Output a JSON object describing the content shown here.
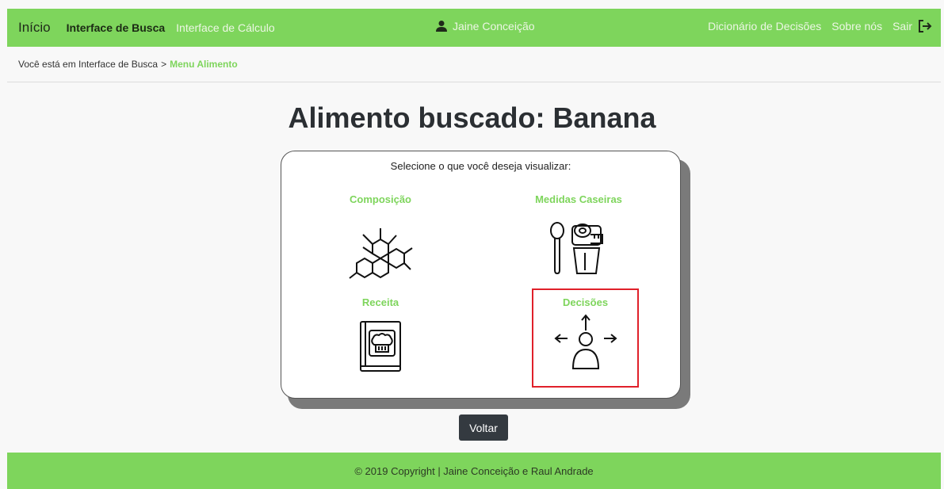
{
  "navbar": {
    "brand": "Início",
    "active_item": "Interface de Busca",
    "items": [
      "Interface de Cálculo"
    ],
    "user_name": "Jaine Conceição",
    "right_items": [
      "Dicionário de Decisões",
      "Sobre nós",
      "Sair"
    ],
    "color": "#7ed55c"
  },
  "breadcrumb": {
    "prefix": "Você está em Interface de Busca",
    "separator": ">",
    "current": "Menu Alimento"
  },
  "page": {
    "title": "Alimento buscado: Banana"
  },
  "card": {
    "prompt": "Selecione o que você deseja visualizar:",
    "options": [
      {
        "label": "Composição",
        "icon": "molecule-icon"
      },
      {
        "label": "Medidas Caseiras",
        "icon": "kitchen-measures-icon"
      },
      {
        "label": "Receita",
        "icon": "recipe-book-icon"
      },
      {
        "label": "Decisões",
        "icon": "decision-person-icon",
        "selected": true
      }
    ]
  },
  "back_button": {
    "label": "Voltar"
  },
  "footer": {
    "text": "© 2019 Copyright | Jaine Conceição e Raul Andrade"
  }
}
